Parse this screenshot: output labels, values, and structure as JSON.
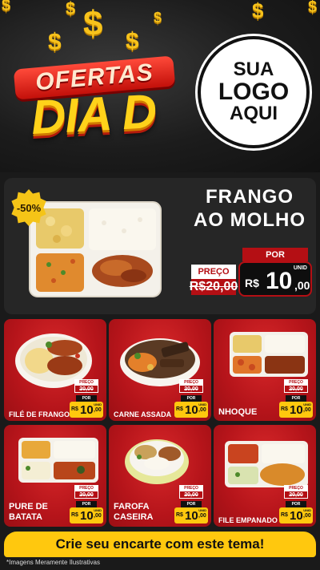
{
  "header": {
    "coin_symbol": "$",
    "title_top": "OFERTAS",
    "title_bottom": "DIA D",
    "logo_line1": "SUA",
    "logo_line2": "LOGO",
    "logo_line3": "AQUI"
  },
  "featured": {
    "discount": "-50%",
    "name_line1": "FRANGO",
    "name_line2": "AO MOLHO",
    "price_label": "PREÇO",
    "old_price": "R$20,00",
    "por_label": "POR",
    "new_price_currency": "R$",
    "new_price_int": "10",
    "new_price_dec": ",00",
    "unit": "UNID"
  },
  "products": [
    {
      "name": "FILÉ DE FRANGO",
      "price_label": "PREÇO",
      "old_price": "20,00",
      "por_label": "POR",
      "currency": "R$",
      "price_int": "10",
      "price_dec": ",00",
      "unit": "UNID"
    },
    {
      "name": "CARNE ASSADA",
      "price_label": "PREÇO",
      "old_price": "20,00",
      "por_label": "POR",
      "currency": "R$",
      "price_int": "10",
      "price_dec": ",00",
      "unit": "UNID"
    },
    {
      "name": "NHOQUE",
      "price_label": "PREÇO",
      "old_price": "20,00",
      "por_label": "POR",
      "currency": "R$",
      "price_int": "10",
      "price_dec": ",00",
      "unit": "UNID"
    },
    {
      "name_line1": "PURE DE",
      "name_line2": "BATATA",
      "price_label": "PREÇO",
      "old_price": "20,00",
      "por_label": "POR",
      "currency": "R$",
      "price_int": "10",
      "price_dec": ",00",
      "unit": "UNID"
    },
    {
      "name_line1": "FAROFA",
      "name_line2": "CASEIRA",
      "price_label": "PREÇO",
      "old_price": "20,00",
      "por_label": "POR",
      "currency": "R$",
      "price_int": "10",
      "price_dec": ",00",
      "unit": "UNID"
    },
    {
      "name": "FILE EMPANADO",
      "price_label": "PREÇO",
      "old_price": "20,00",
      "por_label": "POR",
      "currency": "R$",
      "price_int": "10",
      "price_dec": ",00",
      "unit": "UNID"
    }
  ],
  "footer": {
    "cta": "Crie seu encarte com este tema!",
    "disclaimer": "*Imagens Meramente Ilustrativas"
  },
  "colors": {
    "brand_red": "#b40f14",
    "accent_yellow": "#ffc80e",
    "background_dark": "#1a1a1a"
  }
}
